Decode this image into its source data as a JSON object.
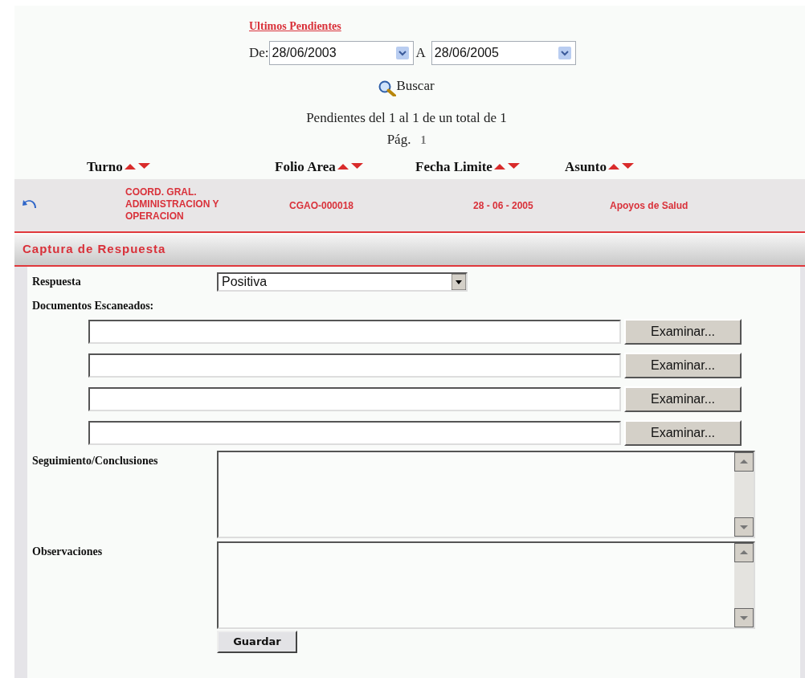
{
  "title": "Ultimos Pendientes",
  "date_range": {
    "from_label": "De:",
    "from": "28/06/2003",
    "to_label": "A",
    "to": "28/06/2005"
  },
  "search_button": "Buscar",
  "summary": "Pendientes del 1 al 1 de un total de 1",
  "pagination": {
    "label": "Pág.",
    "pages": [
      {
        "label": "1",
        "selected": true
      }
    ]
  },
  "table": {
    "columns": [
      "Turno",
      "Folio Area",
      "Fecha Limite",
      "Asunto"
    ],
    "rows": [
      {
        "turno": "COORD. GRAL. ADMINISTRACION Y OPERACION",
        "folio": "CGAO-000018",
        "fecha": "28 - 06 - 2005",
        "asunto": "Apoyos de Salud"
      }
    ]
  },
  "section": {
    "title": "Captura de Respuesta",
    "respuesta": {
      "label": "Respuesta",
      "value": "Positiva"
    },
    "documents_label": "Documentos Escaneados:",
    "file_inputs": [
      {
        "button": "Examinar..."
      },
      {
        "button": "Examinar..."
      },
      {
        "button": "Examinar..."
      },
      {
        "button": "Examinar..."
      }
    ],
    "text_areas": [
      {
        "label": "Seguimiento/Conclusiones"
      },
      {
        "label": "Observaciones"
      }
    ],
    "save_button": "Guardar"
  }
}
